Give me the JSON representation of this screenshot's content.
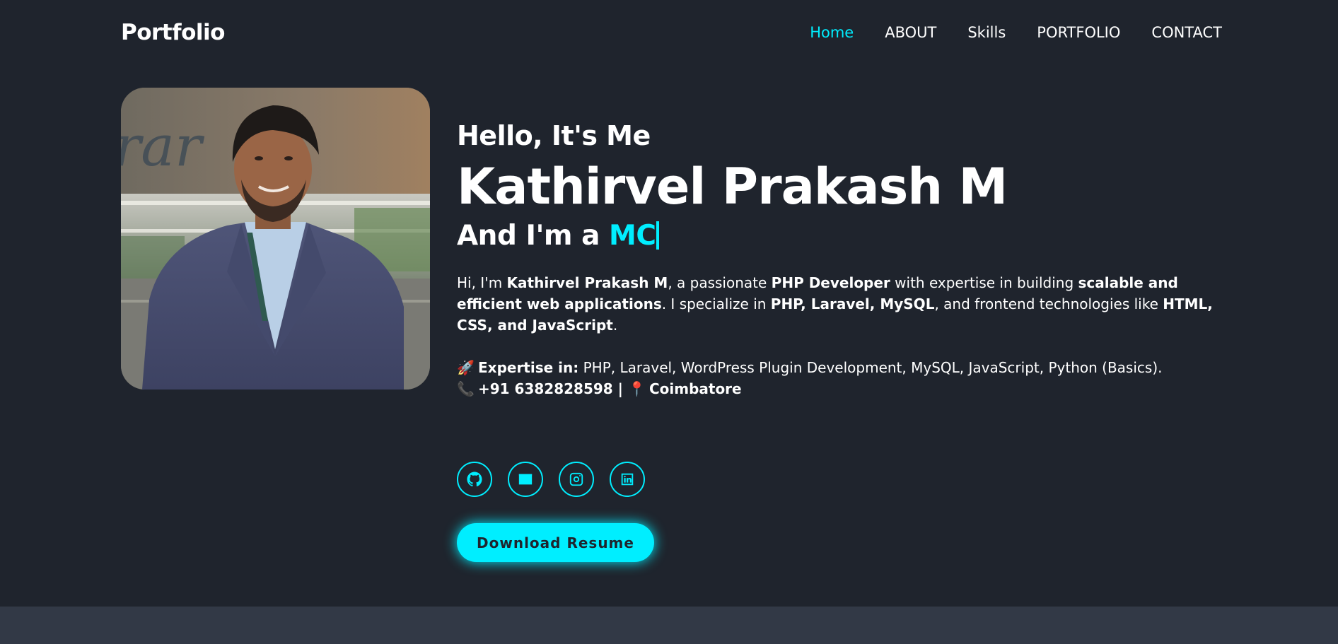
{
  "header": {
    "logo": "Portfolio",
    "nav": [
      {
        "label": "Home",
        "active": true
      },
      {
        "label": "ABOUT",
        "active": false
      },
      {
        "label": "Skills",
        "active": false
      },
      {
        "label": "PORTFOLIO",
        "active": false
      },
      {
        "label": "CONTACT",
        "active": false
      }
    ]
  },
  "hero": {
    "greeting": "Hello, It's Me",
    "name": "Kathirvel Prakash M",
    "role_prefix": "And I'm a ",
    "role_typed": "MC",
    "bio": {
      "p1": "Hi, I'm ",
      "b1": "Kathirvel Prakash M",
      "p2": ", a passionate ",
      "b2": "PHP Developer",
      "p3": " with expertise in building ",
      "b3": "scalable and efficient web applications",
      "p4": ". I specialize in ",
      "b4": "PHP, Laravel, MySQL",
      "p5": ", and frontend technologies like ",
      "b5": "HTML, CSS, and JavaScript",
      "p6": "."
    },
    "expertise_label": "Expertise in:",
    "expertise_value": " PHP, Laravel, WordPress Plugin Development, MySQL, JavaScript, Python (Basics).",
    "phone": "+91 6382828598",
    "separator": " | ",
    "location": "Coimbatore",
    "icons": {
      "rocket": "🚀",
      "phone": "📞",
      "pin": "📍"
    }
  },
  "socials": [
    "github-icon",
    "email-icon",
    "instagram-icon",
    "linkedin-icon"
  ],
  "download_button": "Download Resume",
  "colors": {
    "background": "#1f242d",
    "accent": "#00eeff",
    "strip": "#323946"
  }
}
